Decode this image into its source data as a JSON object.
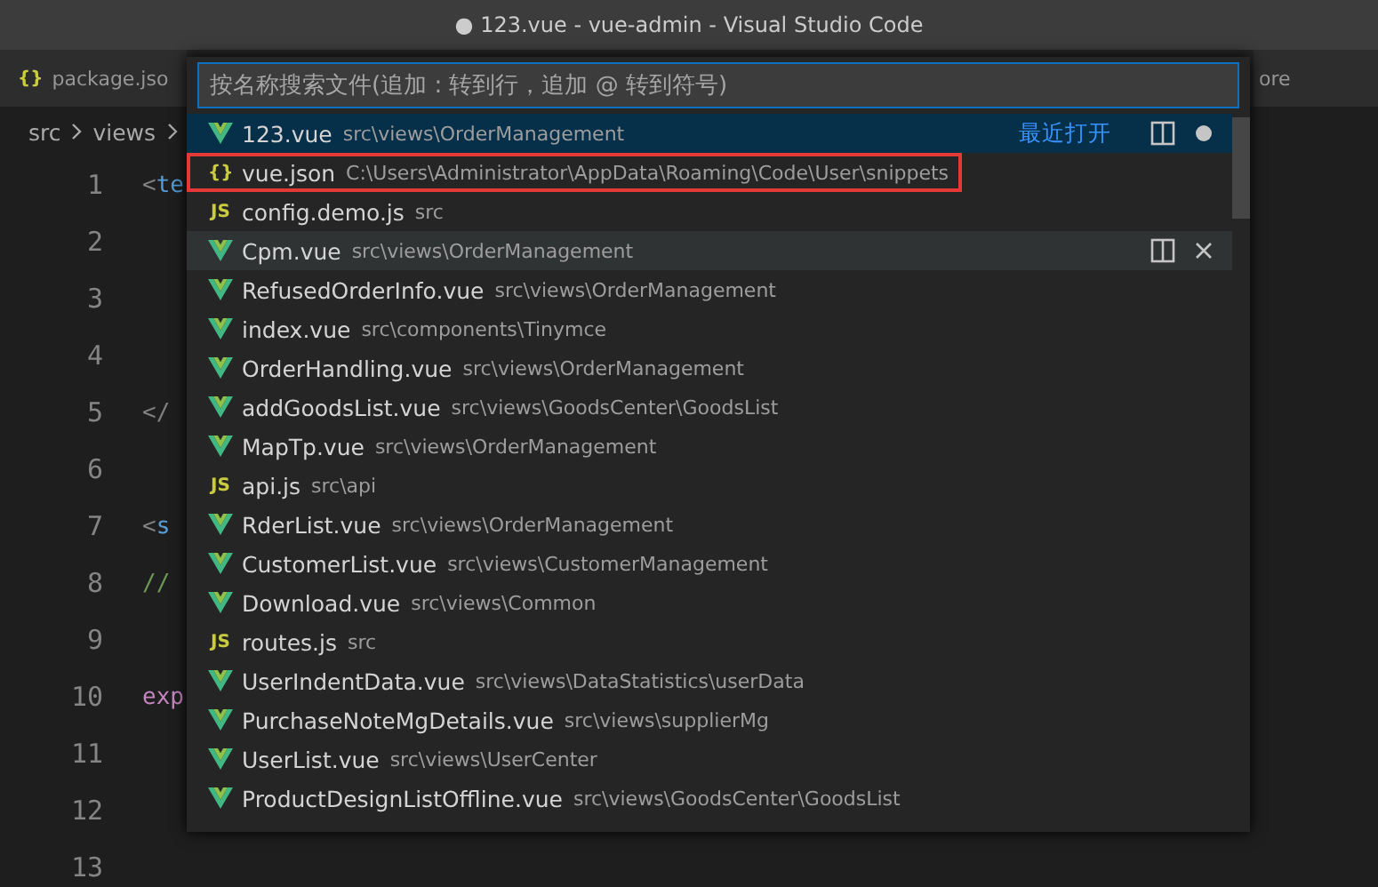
{
  "window": {
    "title": "● 123.vue - vue-admin - Visual Studio Code"
  },
  "tabs": [
    {
      "label": "package.jso",
      "icon": "{}",
      "selected": false
    },
    {
      "label": "ore",
      "selected": false
    }
  ],
  "breadcrumb": [
    "src",
    "views"
  ],
  "editor": {
    "lines": [
      {
        "number": "1",
        "tokens": [
          {
            "text": "<",
            "kind": "punct"
          },
          {
            "text": "te",
            "kind": "tag"
          }
        ]
      },
      {
        "number": "2"
      },
      {
        "number": "3"
      },
      {
        "number": "4"
      },
      {
        "number": "5",
        "tokens": [
          {
            "text": "</",
            "kind": "punct"
          }
        ]
      },
      {
        "number": "6"
      },
      {
        "number": "7",
        "tokens": [
          {
            "text": "<",
            "kind": "punct"
          },
          {
            "text": "s",
            "kind": "tag"
          }
        ]
      },
      {
        "number": "8",
        "tokens": [
          {
            "text": "//",
            "kind": "comment"
          }
        ]
      },
      {
        "number": "9"
      },
      {
        "number": "10",
        "tokens": [
          {
            "text": "exp",
            "kind": "keyword"
          }
        ]
      },
      {
        "number": "11"
      },
      {
        "number": "12"
      },
      {
        "number": "13"
      }
    ]
  },
  "quick_open": {
    "placeholder": "按名称搜索文件(追加 : 转到行，追加 @ 转到符号)",
    "items": [
      {
        "kind": "vue",
        "name": "123.vue",
        "path": "src\\views\\OrderManagement",
        "selected": true,
        "hovered": false,
        "outlined": false,
        "badge": "最近打开",
        "dirty": true
      },
      {
        "kind": "json",
        "icon": "{}",
        "name": "vue.json",
        "path": "C:\\Users\\Administrator\\AppData\\Roaming\\Code\\User\\snippets",
        "selected": false,
        "hovered": false,
        "outlined": true
      },
      {
        "kind": "js",
        "icon": "JS",
        "name": "config.demo.js",
        "path": "src",
        "selected": false,
        "hovered": false,
        "outlined": false
      },
      {
        "kind": "vue",
        "name": "Cpm.vue",
        "path": "src\\views\\OrderManagement",
        "selected": false,
        "hovered": true,
        "outlined": false,
        "dirty": false
      },
      {
        "kind": "vue",
        "name": "RefusedOrderInfo.vue",
        "path": "src\\views\\OrderManagement",
        "selected": false,
        "hovered": false,
        "outlined": false
      },
      {
        "kind": "vue",
        "name": "index.vue",
        "path": "src\\components\\Tinymce",
        "selected": false,
        "hovered": false,
        "outlined": false
      },
      {
        "kind": "vue",
        "name": "OrderHandling.vue",
        "path": "src\\views\\OrderManagement",
        "selected": false,
        "hovered": false,
        "outlined": false
      },
      {
        "kind": "vue",
        "name": "addGoodsList.vue",
        "path": "src\\views\\GoodsCenter\\GoodsList",
        "selected": false,
        "hovered": false,
        "outlined": false
      },
      {
        "kind": "vue",
        "name": "MapTp.vue",
        "path": "src\\views\\OrderManagement",
        "selected": false,
        "hovered": false,
        "outlined": false
      },
      {
        "kind": "js",
        "icon": "JS",
        "name": "api.js",
        "path": "src\\api",
        "selected": false,
        "hovered": false,
        "outlined": false
      },
      {
        "kind": "vue",
        "name": "RderList.vue",
        "path": "src\\views\\OrderManagement",
        "selected": false,
        "hovered": false,
        "outlined": false
      },
      {
        "kind": "vue",
        "name": "CustomerList.vue",
        "path": "src\\views\\CustomerManagement",
        "selected": false,
        "hovered": false,
        "outlined": false
      },
      {
        "kind": "vue",
        "name": "Download.vue",
        "path": "src\\views\\Common",
        "selected": false,
        "hovered": false,
        "outlined": false
      },
      {
        "kind": "js",
        "icon": "JS",
        "name": "routes.js",
        "path": "src",
        "selected": false,
        "hovered": false,
        "outlined": false
      },
      {
        "kind": "vue",
        "name": "UserIndentData.vue",
        "path": "src\\views\\DataStatistics\\userData",
        "selected": false,
        "hovered": false,
        "outlined": false
      },
      {
        "kind": "vue",
        "name": "PurchaseNoteMgDetails.vue",
        "path": "src\\views\\supplierMg",
        "selected": false,
        "hovered": false,
        "outlined": false
      },
      {
        "kind": "vue",
        "name": "UserList.vue",
        "path": "src\\views\\UserCenter",
        "selected": false,
        "hovered": false,
        "outlined": false
      },
      {
        "kind": "vue",
        "name": "ProductDesignListOffline.vue",
        "path": "src\\views\\GoodsCenter\\GoodsList",
        "selected": false,
        "hovered": false,
        "outlined": false
      }
    ]
  }
}
